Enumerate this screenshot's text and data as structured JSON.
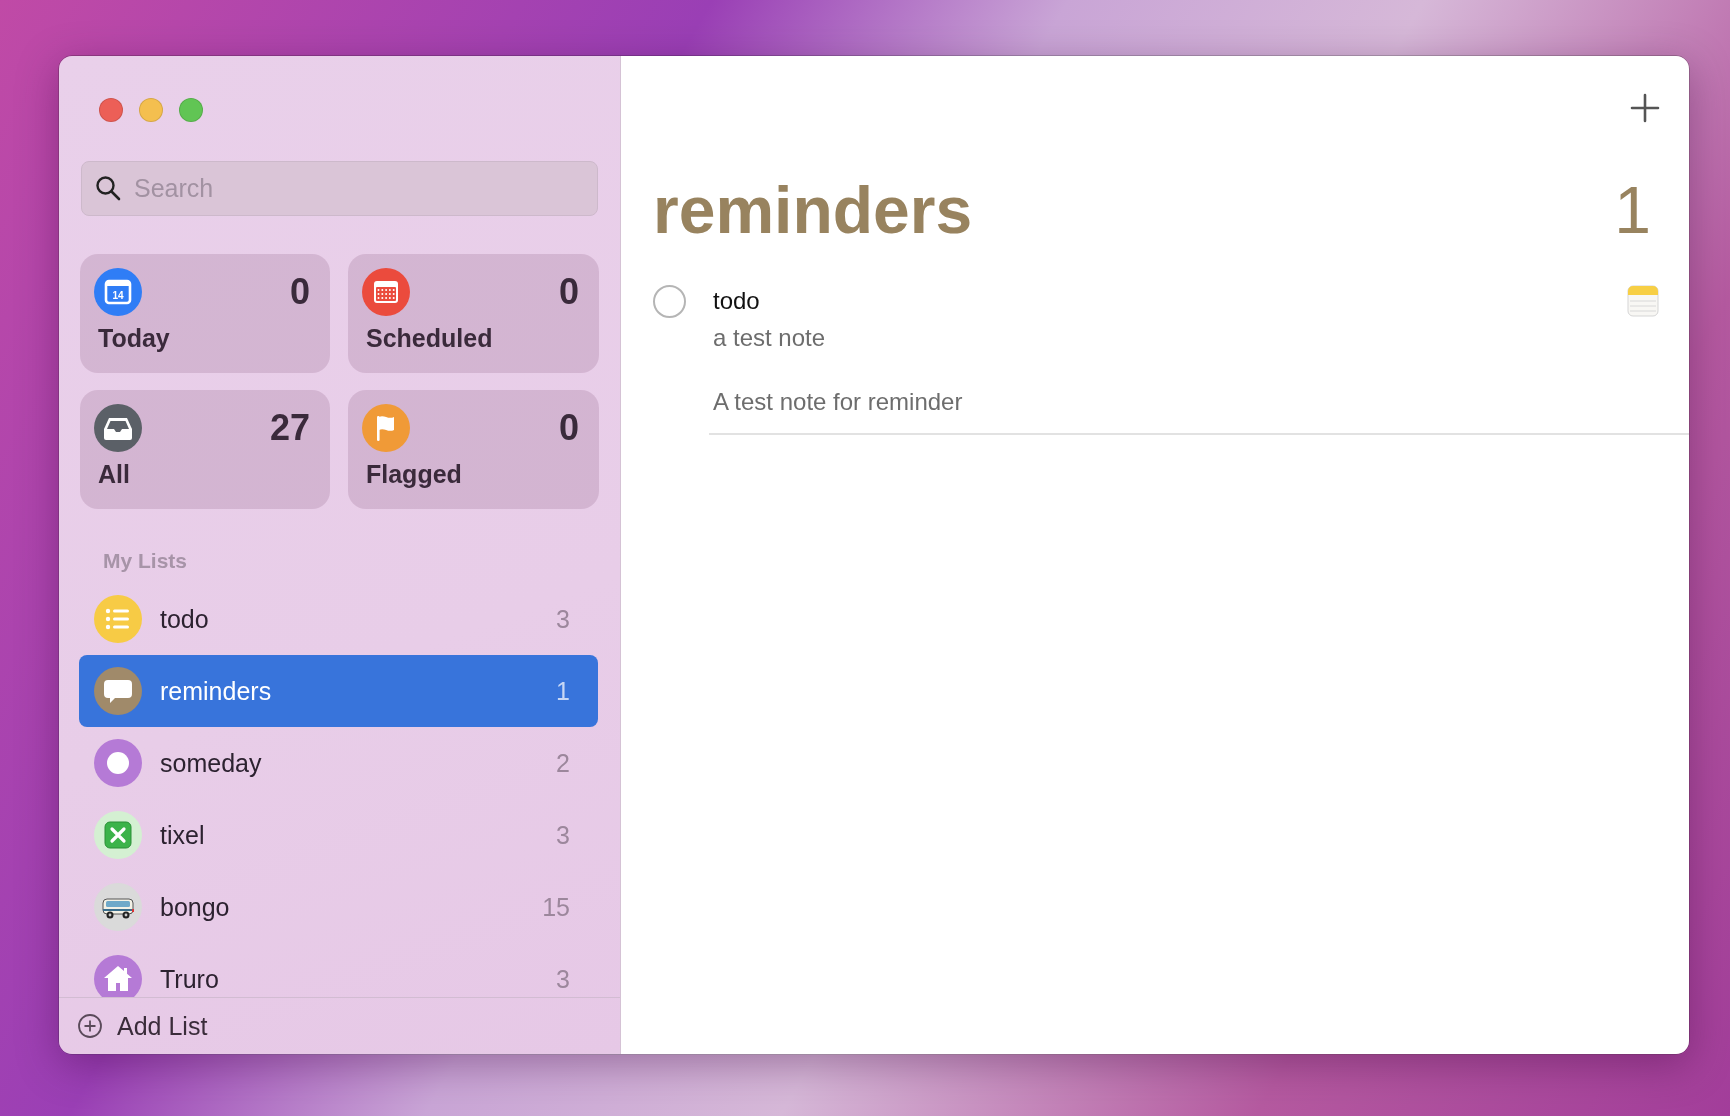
{
  "window": {
    "traffic_lights": [
      {
        "kind": "close",
        "color": "#ec5f57"
      },
      {
        "kind": "minimize",
        "color": "#f4bf4f"
      },
      {
        "kind": "zoom",
        "color": "#61c554"
      }
    ]
  },
  "search": {
    "placeholder": "Search"
  },
  "smart_lists": [
    {
      "kind": "today",
      "label": "Today",
      "count": "0",
      "color": "#2f7df6",
      "date": "14"
    },
    {
      "kind": "scheduled",
      "label": "Scheduled",
      "count": "0",
      "color": "#eb4b3d"
    },
    {
      "kind": "all",
      "label": "All",
      "count": "27",
      "color": "#5b6067"
    },
    {
      "kind": "flagged",
      "label": "Flagged",
      "count": "0",
      "color": "#f09a37"
    }
  ],
  "my_lists": {
    "heading": "My Lists",
    "items": [
      {
        "kind": "list",
        "name": "todo",
        "count": "3",
        "color": "#f7cb45",
        "selected": false
      },
      {
        "kind": "speech",
        "name": "reminders",
        "count": "1",
        "color": "#a08a6a",
        "selected": true
      },
      {
        "kind": "circle",
        "name": "someday",
        "count": "2",
        "color": "#b57ad6",
        "selected": false
      },
      {
        "kind": "cross",
        "name": "tixel",
        "count": "3",
        "color": "#d4f0d2",
        "selected": false
      },
      {
        "kind": "van",
        "name": "bongo",
        "count": "15",
        "color": "#dadada",
        "selected": false
      },
      {
        "kind": "house",
        "name": "Truro",
        "count": "3",
        "color": "#b57ad6",
        "selected": false
      }
    ]
  },
  "add_list": {
    "label": "Add List"
  },
  "detail": {
    "title": "reminders",
    "count": "1",
    "color": "#98835f",
    "reminders": [
      {
        "title": "todo",
        "subtitle": "a test note",
        "note": "A test note for reminder",
        "completed": false,
        "has_note_attachment": true
      }
    ]
  }
}
